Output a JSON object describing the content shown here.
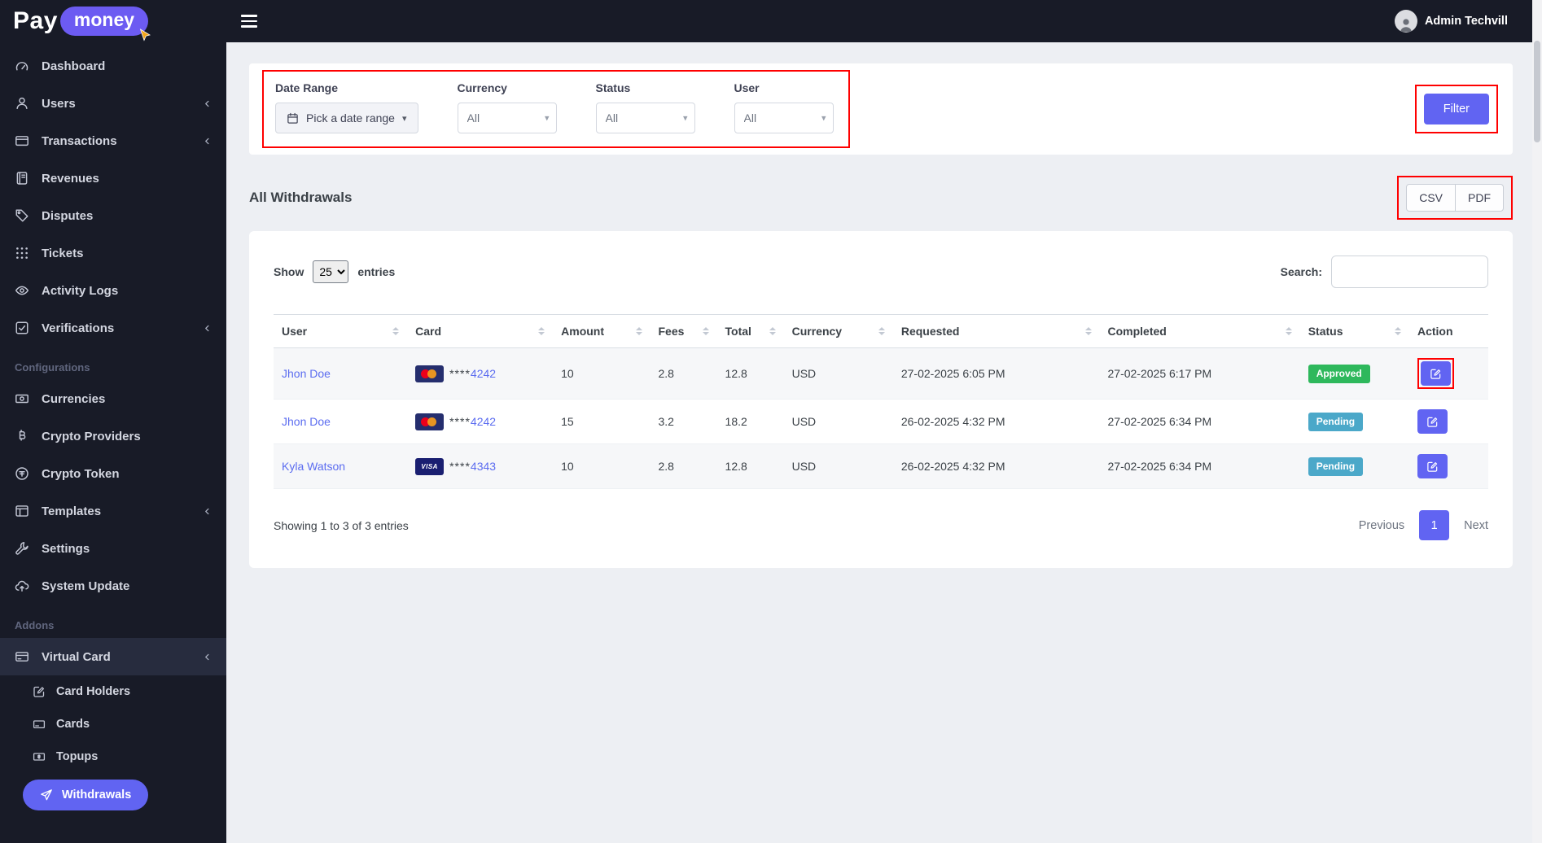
{
  "topbar": {
    "brand_pay": "Pay",
    "brand_money": "money",
    "admin_name": "Admin Techvill"
  },
  "sidebar": {
    "items": [
      {
        "type": "item",
        "label": "Dashboard",
        "icon": "gauge"
      },
      {
        "type": "item",
        "label": "Users",
        "icon": "user",
        "chevron": true
      },
      {
        "type": "item",
        "label": "Transactions",
        "icon": "transactions",
        "chevron": true
      },
      {
        "type": "item",
        "label": "Revenues",
        "icon": "journal"
      },
      {
        "type": "item",
        "label": "Disputes",
        "icon": "tag"
      },
      {
        "type": "item",
        "label": "Tickets",
        "icon": "dots"
      },
      {
        "type": "item",
        "label": "Activity Logs",
        "icon": "eye"
      },
      {
        "type": "item",
        "label": "Verifications",
        "icon": "check-square",
        "chevron": true
      },
      {
        "type": "section",
        "label": "Configurations"
      },
      {
        "type": "item",
        "label": "Currencies",
        "icon": "cash"
      },
      {
        "type": "item",
        "label": "Crypto Providers",
        "icon": "bitcoin"
      },
      {
        "type": "item",
        "label": "Crypto Token",
        "icon": "token"
      },
      {
        "type": "item",
        "label": "Templates",
        "icon": "template",
        "chevron": true
      },
      {
        "type": "item",
        "label": "Settings",
        "icon": "wrench"
      },
      {
        "type": "item",
        "label": "System Update",
        "icon": "cloud-upload"
      },
      {
        "type": "section",
        "label": "Addons"
      },
      {
        "type": "item",
        "label": "Virtual Card",
        "icon": "credit-card",
        "chevron": true,
        "expanded": true
      },
      {
        "type": "sub",
        "label": "Card Holders",
        "icon": "pencil-square"
      },
      {
        "type": "sub",
        "label": "Cards",
        "icon": "card"
      },
      {
        "type": "sub",
        "label": "Topups",
        "icon": "topup"
      },
      {
        "type": "sub",
        "label": "Withdrawals",
        "icon": "send",
        "active": true
      }
    ]
  },
  "filters": {
    "date_range": {
      "label": "Date Range",
      "value": "Pick a date range"
    },
    "currency": {
      "label": "Currency",
      "value": "All"
    },
    "status": {
      "label": "Status",
      "value": "All"
    },
    "user": {
      "label": "User",
      "value": "All"
    },
    "filter_button": "Filter"
  },
  "page": {
    "heading": "All Withdrawals",
    "export_csv": "CSV",
    "export_pdf": "PDF"
  },
  "table": {
    "show_label": "Show",
    "page_size": "25",
    "entries_label": "entries",
    "search_label": "Search:",
    "columns": [
      "User",
      "Card",
      "Amount",
      "Fees",
      "Total",
      "Currency",
      "Requested",
      "Completed",
      "Status",
      "Action"
    ],
    "rows": [
      {
        "user": "Jhon Doe",
        "card_brand": "mastercard",
        "card_number": "****4242",
        "amount": "10",
        "fees": "2.8",
        "total": "12.8",
        "currency": "USD",
        "requested": "27-02-2025 6:05 PM",
        "completed": "27-02-2025 6:17 PM",
        "status": "Approved",
        "action_highlight": true
      },
      {
        "user": "Jhon Doe",
        "card_brand": "mastercard",
        "card_number": "****4242",
        "amount": "15",
        "fees": "3.2",
        "total": "18.2",
        "currency": "USD",
        "requested": "26-02-2025 4:32 PM",
        "completed": "27-02-2025 6:34 PM",
        "status": "Pending",
        "action_highlight": false
      },
      {
        "user": "Kyla Watson",
        "card_brand": "visa",
        "card_number": "****4343",
        "amount": "10",
        "fees": "2.8",
        "total": "12.8",
        "currency": "USD",
        "requested": "26-02-2025 4:32 PM",
        "completed": "27-02-2025 6:34 PM",
        "status": "Pending",
        "action_highlight": false
      }
    ],
    "summary": "Showing 1 to 3 of 3 entries",
    "pagination": {
      "previous": "Previous",
      "page": "1",
      "next": "Next"
    }
  },
  "colors": {
    "accent": "#6164f2",
    "logo_pill": "#6c5bf2",
    "cursor_yellow": "#f2a51a",
    "highlight_red": "#ff0000",
    "status": {
      "Approved": "#2eb85c",
      "Pending": "#4ba8c9"
    }
  }
}
